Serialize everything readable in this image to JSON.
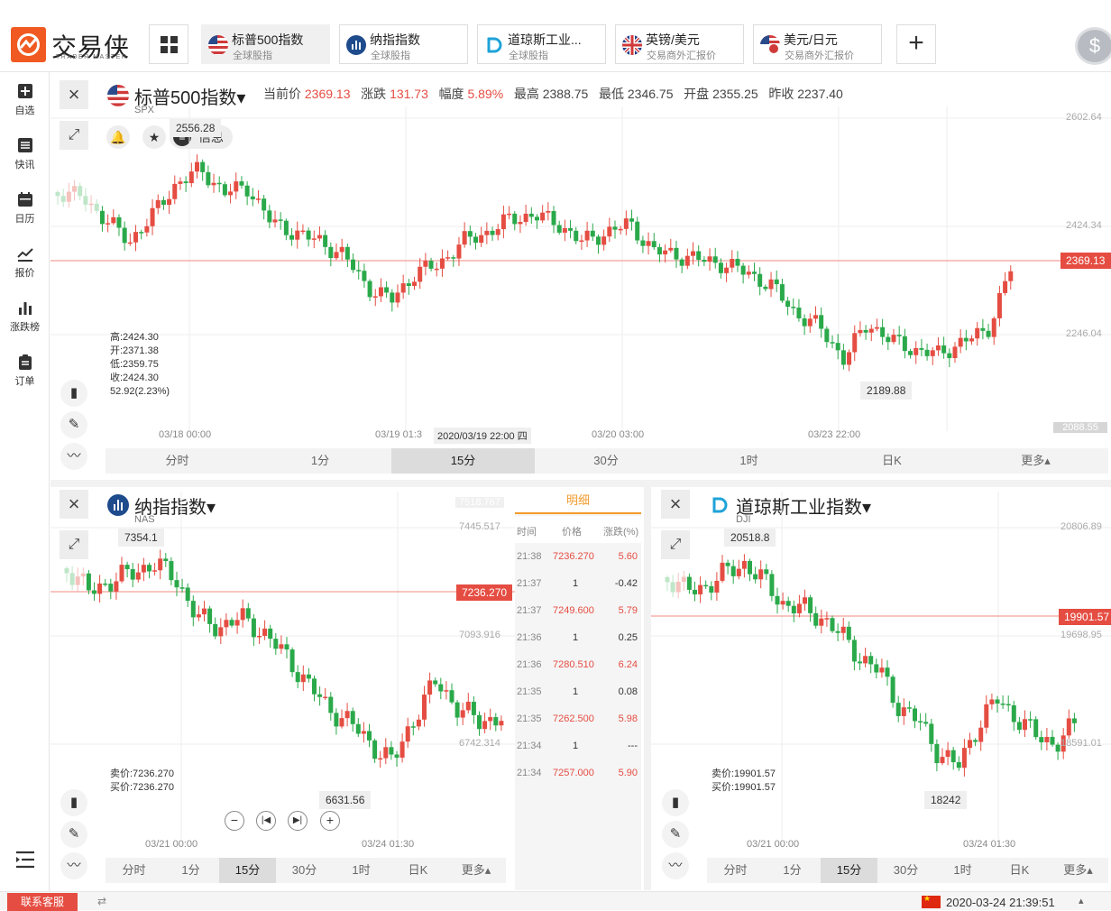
{
  "app": {
    "logo_text": "交易侠",
    "logo_sub": "TRADER MASTER",
    "brand_color": "#f05a22"
  },
  "tabs": [
    {
      "name": "标普500指数",
      "sub": "全球股指",
      "active": true
    },
    {
      "name": "纳指指数",
      "sub": "全球股指"
    },
    {
      "name": "道琼斯工业...",
      "sub": "全球股指"
    },
    {
      "name": "英镑/美元",
      "sub": "交易商外汇报价"
    },
    {
      "name": "美元/日元",
      "sub": "交易商外汇报价"
    }
  ],
  "sidebar": [
    {
      "label": "自选",
      "icon": "add-icon"
    },
    {
      "label": "快讯",
      "icon": "list-icon"
    },
    {
      "label": "日历",
      "icon": "calendar-icon"
    },
    {
      "label": "报价",
      "icon": "trend-icon"
    },
    {
      "label": "涨跌榜",
      "icon": "bar-icon"
    },
    {
      "label": "订单",
      "icon": "clipboard-icon"
    }
  ],
  "main": {
    "title": "标普500指数",
    "code": "SPX",
    "quote": {
      "cur_label": "当前价",
      "cur": "2369.13",
      "chg_label": "涨跌",
      "chg": "131.73",
      "pct_label": "幅度",
      "pct": "5.89%",
      "high_label": "最高",
      "high": "2388.75",
      "low_label": "最低",
      "low": "2346.75",
      "open_label": "开盘",
      "open": "2355.25",
      "prev_label": "昨收",
      "prev": "2237.40"
    },
    "info_label": "信息",
    "ohlc": [
      "高:2424.30",
      "开:2371.38",
      "低:2359.75",
      "收:2424.30",
      "52.92(2.23%)"
    ],
    "yaxis": [
      "2602.64",
      "2424.34",
      "2246.04",
      "2088.55"
    ],
    "price_tag": "2369.13",
    "max_label": "2556.28",
    "min_label": "2189.88",
    "times": [
      "03/18 00:00",
      "03/19 01:3",
      "03/20 03:00",
      "03/23 22:00"
    ],
    "cursor_time": "2020/03/19 22:00 四",
    "timeframes": [
      "分时",
      "1分",
      "15分",
      "30分",
      "1时",
      "日K",
      "更多▴"
    ],
    "active_tf": "15分"
  },
  "nas": {
    "title": "纳指指数",
    "code": "NAS",
    "yaxis": [
      "7518.767",
      "7445.517",
      "7093.916",
      "6742.314"
    ],
    "price_tag": "7236.270",
    "max_label": "7354.1",
    "min_label": "6631.56",
    "bidask": [
      "卖价:7236.270",
      "买价:7236.270"
    ],
    "times": [
      "03/21 00:00",
      "03/24 01:30"
    ],
    "timeframes": [
      "分时",
      "1分",
      "15分",
      "30分",
      "1时",
      "日K",
      "更多▴"
    ],
    "active_tf": "15分"
  },
  "detail": {
    "tab": "明细",
    "headers": [
      "时间",
      "价格",
      "涨跌(%)"
    ],
    "rows": [
      {
        "time": "21:38",
        "price": "7236.270",
        "chg": "5.60",
        "red": true
      },
      {
        "time": "21:37",
        "price": "1",
        "chg": "-0.42",
        "red": false
      },
      {
        "time": "21:37",
        "price": "7249.600",
        "chg": "5.79",
        "red": true
      },
      {
        "time": "21:36",
        "price": "1",
        "chg": "0.25",
        "red": false
      },
      {
        "time": "21:36",
        "price": "7280.510",
        "chg": "6.24",
        "red": true
      },
      {
        "time": "21:35",
        "price": "1",
        "chg": "0.08",
        "red": false
      },
      {
        "time": "21:35",
        "price": "7262.500",
        "chg": "5.98",
        "red": true
      },
      {
        "time": "21:34",
        "price": "1",
        "chg": "---",
        "red": false
      },
      {
        "time": "21:34",
        "price": "7257.000",
        "chg": "5.90",
        "red": true
      }
    ]
  },
  "dji": {
    "title": "道琼斯工业指数",
    "code": "DJI",
    "yaxis": [
      "20806.89",
      "19698.95",
      "18591.01"
    ],
    "price_tag": "19901.57",
    "max_label": "20518.8",
    "min_label": "18242",
    "bidask": [
      "卖价:19901.57",
      "买价:19901.57"
    ],
    "times": [
      "03/21 00:00",
      "03/24 01:30"
    ],
    "timeframes": [
      "分时",
      "1分",
      "15分",
      "30分",
      "1时",
      "日K",
      "更多▴"
    ],
    "active_tf": "15分"
  },
  "footer": {
    "service": "联系客服",
    "datetime": "2020-03-24 21:39:51"
  },
  "colors": {
    "up": "#e54d42",
    "down": "#2aa94a",
    "accent": "#f39b2b"
  }
}
